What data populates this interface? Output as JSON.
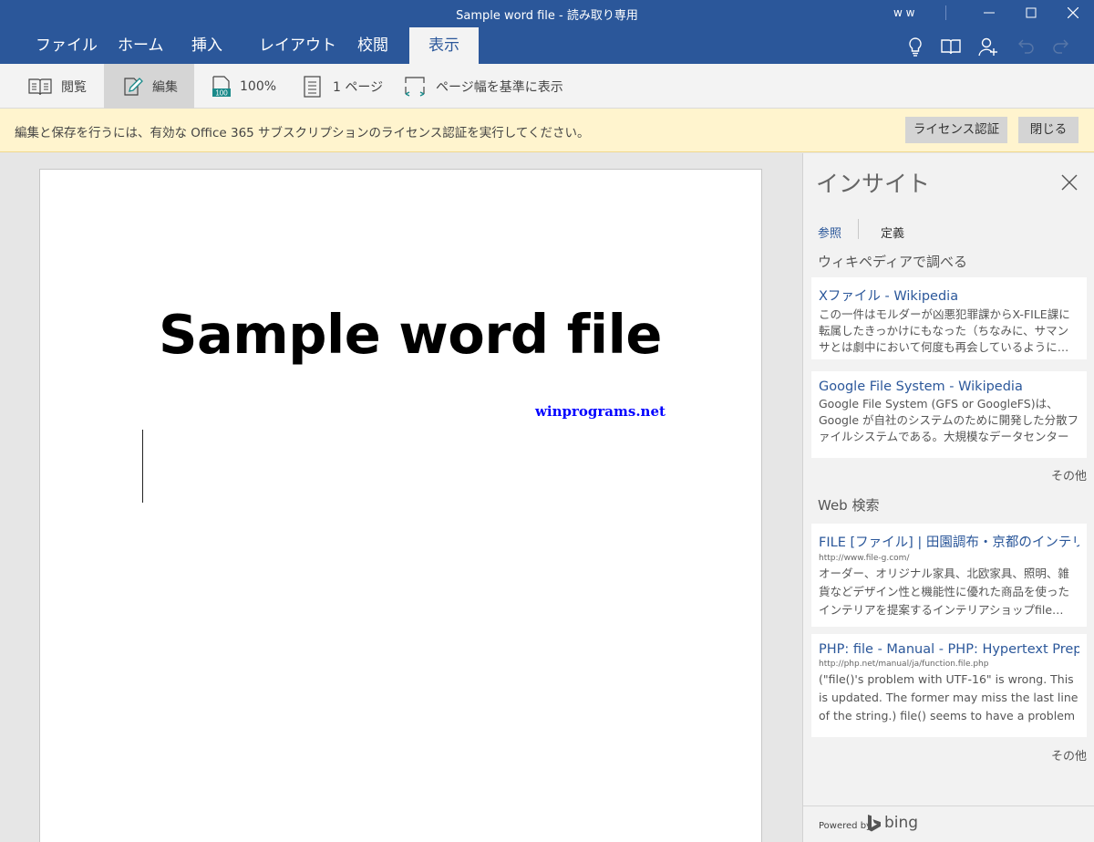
{
  "window": {
    "title": "Sample word file - 読み取り専用",
    "user": "w w"
  },
  "tabs": [
    {
      "label": "ファイル"
    },
    {
      "label": "ホーム"
    },
    {
      "label": "挿入"
    },
    {
      "label": "レイアウト"
    },
    {
      "label": "校閲"
    },
    {
      "label": "表示",
      "active": true
    }
  ],
  "ribbon": {
    "read_label": "閲覧",
    "edit_label": "編集",
    "zoom_label": "100%",
    "zoom_icon_text": "100",
    "one_page_label": "1 ページ",
    "page_width_label": "ページ幅を基準に表示"
  },
  "message_bar": {
    "text": "編集と保存を行うには、有効な Office 365 サブスクリプションのライセンス認証を実行してください。",
    "activate_label": "ライセンス認証",
    "close_label": "閉じる",
    "color": "#fff4ce"
  },
  "document": {
    "title": "Sample word file",
    "link": "winprograms.net"
  },
  "insights": {
    "title": "インサイト",
    "tabs": [
      "参照",
      "定義"
    ],
    "wiki_section": "ウィキペディアで調べる",
    "wiki_results": [
      {
        "title": "Xファイル - Wikipedia",
        "body": "この一件はモルダーが凶悪犯罪課からX-FILE課に転属したきっかけにもなった（ちなみに、サマンサとは劇中において何度も再会しているように…"
      },
      {
        "title": "Google File System - Wikipedia",
        "body": "Google File System (GFS or GoogleFS)は、Google が自社のシステムのために開発した分散ファイルシステムである。大規模なデータセンターに格…"
      }
    ],
    "more_label": "その他",
    "web_section": "Web 検索",
    "web_results": [
      {
        "title": "FILE [ファイル] | 田園調布・京都のインテリア",
        "url": "http://www.file-g.com/",
        "body": "オーダー、オリジナル家具、北欧家具、照明、雑貨などデザイン性と機能性に優れた商品を使ったインテリアを提案するインテリアショップfile…"
      },
      {
        "title": "PHP: file - Manual - PHP: Hypertext Preprocessor",
        "url": "http://php.net/manual/ja/function.file.php",
        "body": "(\"file()'s problem with UTF-16\" is wrong. This is updated. The former may miss the last line of the string.) file() seems to have a problem in handling…"
      }
    ],
    "powered_by": "Powered by",
    "bing": "bing"
  },
  "colors": {
    "accent": "#2b579a",
    "link": "#0000ff"
  }
}
